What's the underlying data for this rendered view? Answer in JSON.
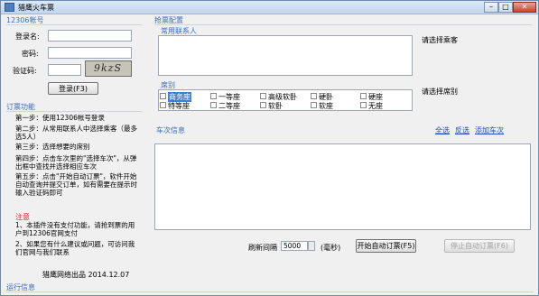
{
  "window": {
    "title": "猎鹰火车票"
  },
  "account": {
    "group_title": "12306帐号",
    "username_label": "登录名:",
    "password_label": "密码:",
    "captcha_label": "验证码:",
    "captcha_text": "9kzS",
    "login_button": "登录(F3)"
  },
  "guide": {
    "group_title": "订票功能",
    "steps": [
      "第一步：使用12306帐号登录",
      "第二步：从常用联系人中选择乘客（最多选5人）",
      "第三步：选择想要的席别",
      "第四步：点击车次里的\"选择车次\"，从弹出框中查找并选择相应车次",
      "第五步：点击\"开始自动订票\"，软件开始自动查询并提交订单，如有需要在提示时输入验证码即可"
    ],
    "notice_title": "注意",
    "notes": [
      "1、本插件没有支付功能，请抢到票的用户到12306官网支付",
      "2、如果您有什么建议或问题，可访问我们官网与我们联系"
    ],
    "footer": "猎鹰网络出品 2014.12.07"
  },
  "config": {
    "group_title": "抢票配置",
    "contacts_label": "常用联系人",
    "contacts_hint": "请选择乘客",
    "seat_label": "席别",
    "seat_hint": "请选择席别",
    "seats": [
      "商务座",
      "一等座",
      "高级软卧",
      "硬卧",
      "硬座",
      "特等座",
      "二等座",
      "软卧",
      "软座",
      "无座"
    ]
  },
  "trains": {
    "label": "车次信息",
    "select_all": "全选",
    "invert": "反选",
    "add_train": "添加车次"
  },
  "controls": {
    "refresh_label": "刷新间隔",
    "refresh_value": "5000",
    "unit": "(毫秒)",
    "start_button": "开始自动订票(F5)",
    "stop_button": "停止自动订票(F6)"
  },
  "log": {
    "label": "运行信息"
  }
}
